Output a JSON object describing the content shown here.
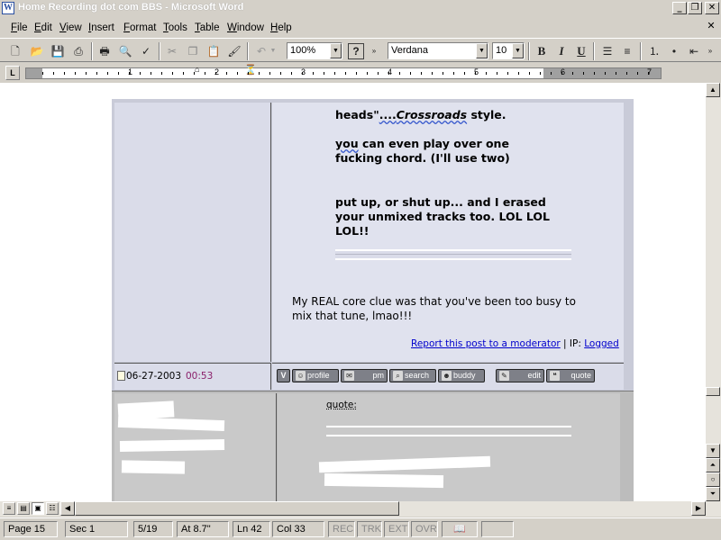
{
  "window": {
    "title": "Home Recording dot com BBS - Microsoft Word",
    "app_icon": "W",
    "min_glyph": "_",
    "max_glyph": "❐",
    "close_glyph": "✕",
    "doc_close_glyph": "✕"
  },
  "menu": {
    "items": [
      {
        "label": "File"
      },
      {
        "label": "Edit"
      },
      {
        "label": "View"
      },
      {
        "label": "Insert"
      },
      {
        "label": "Format"
      },
      {
        "label": "Tools"
      },
      {
        "label": "Table"
      },
      {
        "label": "Window"
      },
      {
        "label": "Help"
      }
    ]
  },
  "toolbar": {
    "zoom": "100%",
    "font": "Verdana",
    "size": "10",
    "bold": "B",
    "italic": "I",
    "underline": "U",
    "help_glyph": "?"
  },
  "ruler": {
    "corner": "L",
    "numbers": [
      "1",
      "2",
      "3",
      "4",
      "5",
      "6",
      "7"
    ]
  },
  "post1": {
    "line1_pre": "heads\"",
    "line1_dots": "....",
    "line1_italic": "Crossroads",
    "line1_post": " style.",
    "line2_sq": "you",
    "line2_rest": " can even play over one",
    "line3": "fucking chord. (I'll use two)",
    "line4": "put up, or shut up... and I erased",
    "line5": "your unmixed tracks too. LOL LOL",
    "line6": "LOL!!",
    "reply1": "My REAL core clue was that you've been too busy to",
    "reply2": "mix that tune, lmao!!!",
    "report_link": "Report this post to a moderator",
    "ip_sep": " | IP: ",
    "ip_link": "Logged",
    "date": "06-27-2003",
    "time": "00:53",
    "buttons": {
      "v": "V",
      "profile": "profile",
      "pm": "pm",
      "search": "search",
      "buddy": "buddy",
      "edit": "edit",
      "quote": "quote"
    }
  },
  "post2": {
    "quote_label": "quote:"
  },
  "statusbar": {
    "page": "Page 15",
    "sec": "Sec 1",
    "pages": "5/19",
    "at": "At 8.7\"",
    "ln": "Ln 42",
    "col": "Col 33",
    "rec": "REC",
    "trk": "TRK",
    "ext": "EXT",
    "ovr": "OVR"
  },
  "colors": {
    "time": "#8a1f6a",
    "link": "#0000cc",
    "post_bg": "#e0e2ee",
    "gray_row": "#c9c9c9"
  }
}
